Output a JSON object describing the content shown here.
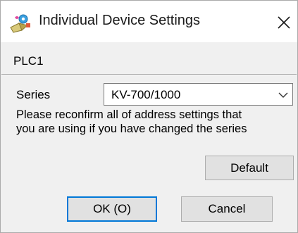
{
  "window": {
    "title": "Individual Device Settings"
  },
  "device": {
    "name": "PLC1"
  },
  "series": {
    "label": "Series",
    "selected_value": "KV-700/1000"
  },
  "note": {
    "line1": "Please reconfirm all of address settings that",
    "line2": "you are using if you have changed the series"
  },
  "buttons": {
    "default_label": "Default",
    "ok_label": "OK (O)",
    "cancel_label": "Cancel"
  },
  "icons": {
    "app": "gp-pro-settings-icon",
    "close": "close-icon",
    "dropdown": "chevron-down-icon"
  },
  "colors": {
    "focus_border": "#0078d7",
    "window_bg": "#f0f0f0",
    "button_bg": "#e1e1e1"
  }
}
